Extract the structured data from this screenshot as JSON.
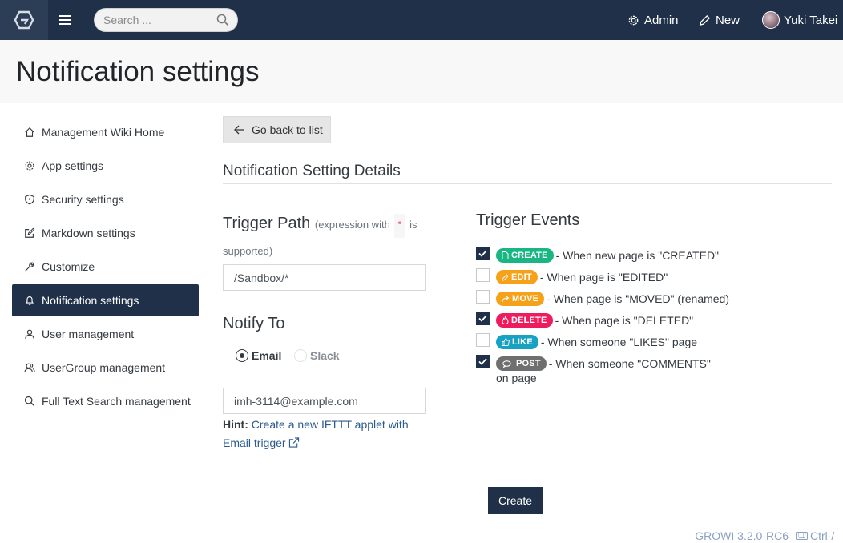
{
  "navbar": {
    "search_placeholder": "Search ...",
    "admin_label": "Admin",
    "new_label": "New",
    "user_name": "Yuki Takei"
  },
  "page": {
    "title": "Notification settings"
  },
  "sidebar": {
    "items": [
      {
        "label": "Management Wiki Home",
        "icon": "home-icon",
        "active": false
      },
      {
        "label": "App settings",
        "icon": "gear-icon",
        "active": false
      },
      {
        "label": "Security settings",
        "icon": "shield-icon",
        "active": false
      },
      {
        "label": "Markdown settings",
        "icon": "edit-icon",
        "active": false
      },
      {
        "label": "Customize",
        "icon": "wrench-icon",
        "active": false
      },
      {
        "label": "Notification settings",
        "icon": "bell-icon",
        "active": true
      },
      {
        "label": "User management",
        "icon": "user-icon",
        "active": false
      },
      {
        "label": "UserGroup management",
        "icon": "user-group-icon",
        "active": false
      },
      {
        "label": "Full Text Search management",
        "icon": "search-icon",
        "active": false
      }
    ]
  },
  "main": {
    "back_label": "Go back to list",
    "section_title": "Notification Setting Details",
    "trigger_path": {
      "title": "Trigger Path",
      "hint_prefix": "(expression with",
      "hint_code": "*",
      "hint_suffix": "is supported)",
      "value": "/Sandbox/*"
    },
    "notify_to": {
      "title": "Notify To",
      "options": [
        {
          "label": "Email",
          "checked": true,
          "disabled": false
        },
        {
          "label": "Slack",
          "checked": false,
          "disabled": true
        }
      ],
      "email_value": "imh-3114@example.com",
      "hint_label": "Hint:",
      "hint_link": "Create a new IFTTT applet with Email trigger"
    },
    "trigger_events": {
      "title": "Trigger Events",
      "events": [
        {
          "badge": "CREATE",
          "color": "#19b583",
          "icon": "file-icon",
          "text": "- When new page is \"CREATED\"",
          "checked": true
        },
        {
          "badge": "EDIT",
          "color": "#f5a21a",
          "icon": "pencil-icon",
          "text": "- When page is \"EDITED\"",
          "checked": false
        },
        {
          "badge": "MOVE",
          "color": "#f5a21a",
          "icon": "share-icon",
          "text": "- When page is \"MOVED\" (renamed)",
          "checked": false
        },
        {
          "badge": "DELETE",
          "color": "#ee1c5f",
          "icon": "fire-icon",
          "text": "- When page is \"DELETED\"",
          "checked": true
        },
        {
          "badge": "LIKE",
          "color": "#17a2c4",
          "icon": "thumbs-up-icon",
          "text": "- When someone \"LIKES\" page",
          "checked": false
        },
        {
          "badge": "POST",
          "color": "#6f6f6f",
          "icon": "comment-icon",
          "text": "- When someone \"COMMENTS\" on page",
          "checked": true
        }
      ]
    },
    "create_label": "Create"
  },
  "footer": {
    "version": "GROWI 3.2.0-RC6",
    "shortcut": "Ctrl-/"
  }
}
